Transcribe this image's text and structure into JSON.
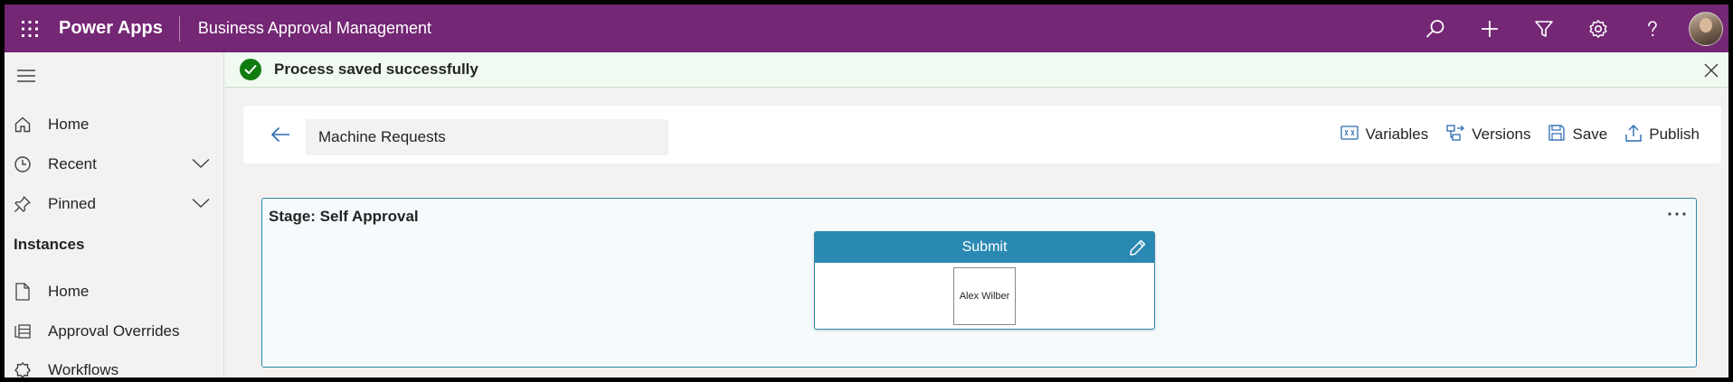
{
  "header": {
    "brand": "Power Apps",
    "app_title": "Business Approval Management",
    "accent_color": "#742774",
    "icons": [
      "waffle-icon",
      "search-icon",
      "plus-icon",
      "filter-icon",
      "settings-icon",
      "help-icon",
      "avatar"
    ]
  },
  "sidebar": {
    "items": [
      {
        "label": "Home",
        "icon": "home-icon"
      },
      {
        "label": "Recent",
        "icon": "clock-icon",
        "expandable": true
      },
      {
        "label": "Pinned",
        "icon": "pin-icon",
        "expandable": true
      }
    ],
    "section_title": "Instances",
    "section_items": [
      {
        "label": "Home",
        "icon": "document-icon"
      },
      {
        "label": "Approval Overrides",
        "icon": "overrides-icon"
      },
      {
        "label": "Workflows",
        "icon": "workflow-icon"
      }
    ]
  },
  "notification": {
    "message": "Process saved successfully",
    "status_color": "#107c10"
  },
  "commandbar": {
    "process_name": "Machine Requests",
    "actions": {
      "variables": "Variables",
      "versions": "Versions",
      "save": "Save",
      "publish": "Publish"
    }
  },
  "stage": {
    "title": "Stage: Self Approval",
    "step": {
      "title": "Submit",
      "approver": "Alex Wilber",
      "header_color": "#2a89b2"
    }
  }
}
